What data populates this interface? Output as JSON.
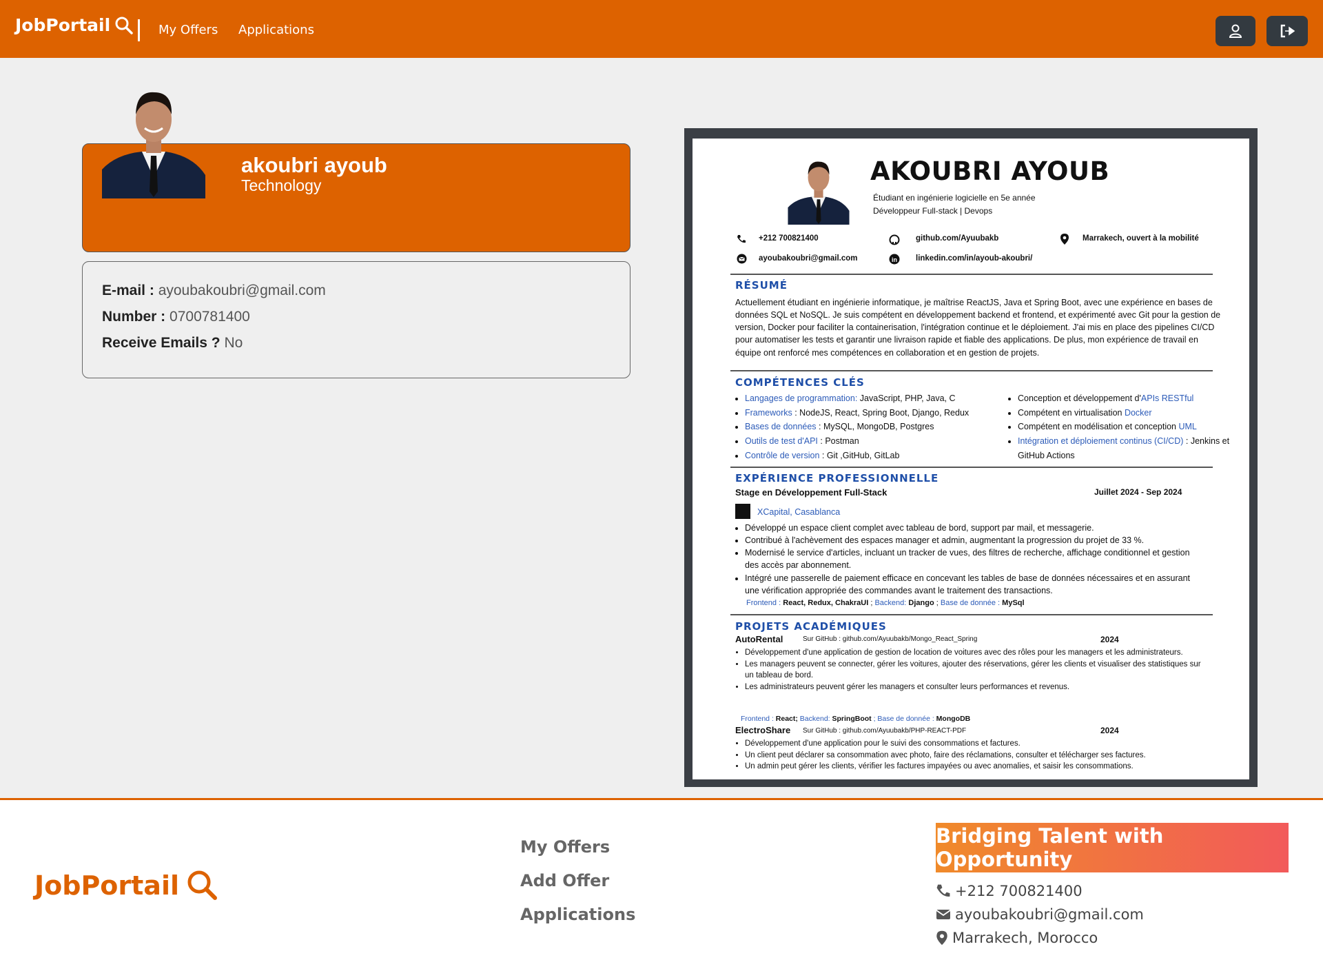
{
  "colors": {
    "brand": "#dd6200",
    "dark_button": "#333a40",
    "footer_text": "#666666"
  },
  "nav": {
    "brand": "JobPortail",
    "brand_icon": "search-icon",
    "links": [
      "My Offers",
      "Applications"
    ],
    "buttons": [
      {
        "icon": "user-icon"
      },
      {
        "icon": "logout-icon"
      }
    ]
  },
  "profile": {
    "name": "akoubri ayoub",
    "field": "Technology",
    "email_label": "E-mail :",
    "email": "ayoubakoubri@gmail.com",
    "number_label": "Number :",
    "number": "0700781400",
    "receive_label": "Receive Emails ?",
    "receive": "No"
  },
  "resume": {
    "name": "AKOUBRI AYOUB",
    "subtitle1": "Étudiant en ingénierie logicielle en 5e année",
    "subtitle2": "Développeur Full-stack | Devops",
    "phone": "+212 700821400",
    "github": "github.com/Ayuubakb",
    "location": "Marrakech, ouvert à la mobilité",
    "email": "ayoubakoubri@gmail.com",
    "linkedin": "linkedin.com/in/ayoub-akoubri/",
    "resume_title": "RÉSUMÉ",
    "resume_text": "Actuellement étudiant en ingénierie informatique, je maîtrise ReactJS, Java et Spring Boot, avec une expérience en bases de données SQL et NoSQL. Je suis compétent en développement backend et frontend, et expérimenté avec Git pour la gestion de version, Docker pour faciliter la containerisation, l'intégration continue et le déploiement. J'ai mis en place des pipelines CI/CD pour automatiser les tests et garantir une livraison rapide et fiable des applications. De plus, mon expérience de travail en équipe ont renforcé mes compétences en collaboration et en gestion de projets.",
    "skills_title": "COMPÉTENCES CLÉS",
    "skills_left": [
      {
        "k": "Langages de programmation:",
        "v": " JavaScript, PHP, Java, C"
      },
      {
        "k": "Frameworks",
        "v": " : NodeJS, React, Spring Boot, Django, Redux"
      },
      {
        "k": "Bases de données",
        "v": " : MySQL, MongoDB, Postgres"
      },
      {
        "k": "Outils de test d'API",
        "v": " : Postman"
      },
      {
        "k": "Contrôle de version",
        "v": " : Git ,GitHub, GitLab"
      }
    ],
    "skills_right": [
      {
        "p": "Conception et développement d'",
        "b": "APIs RESTful",
        "s": ""
      },
      {
        "p": "Compétent en virtualisation ",
        "b": "Docker",
        "s": ""
      },
      {
        "p": "Compétent en modélisation et conception ",
        "b": "UML",
        "s": ""
      },
      {
        "p": "",
        "b": "Intégration et déploiement continus (CI/CD)",
        "s": " : Jenkins et GitHub Actions"
      }
    ],
    "exp_title": "EXPÉRIENCE PROFESSIONNELLE",
    "exp_role": "Stage en Développement Full-Stack",
    "exp_dates": "Juillet 2024 - Sep 2024",
    "exp_company": "XCapital, Casablanca",
    "exp_items": [
      "Développé un espace client complet avec tableau de bord, support par mail, et messagerie.",
      "Contribué à l'achèvement des espaces manager et admin, augmentant la progression du projet de 33 %.",
      "Modernisé le service d'articles, incluant un tracker de vues, des filtres de recherche, affichage conditionnel et gestion des accès par abonnement.",
      "Intégré une passerelle de paiement efficace en concevant les tables de base de données nécessaires et en assurant une vérification appropriée des commandes avant le traitement des transactions."
    ],
    "exp_stack": {
      "f": "Frontend :",
      "fv": " React, Redux, ChakraUI",
      "b": "Backend:",
      "bv": " Django",
      "d": "Base de donnée :",
      "dv": " MySql"
    },
    "proj_title": "PROJETS ACADÉMIQUES",
    "proj1_name": "AutoRental",
    "proj1_link": "Sur GitHub : github.com/Ayuubakb/Mongo_React_Spring",
    "proj1_year": "2024",
    "proj1_items": [
      "Développement d'une application de gestion de location de voitures avec des rôles pour les managers et les administrateurs.",
      "Les managers peuvent se connecter, gérer les voitures, ajouter des réservations, gérer les clients et visualiser des statistiques sur un tableau de bord.",
      "Les administrateurs peuvent gérer les managers et consulter leurs performances et revenus."
    ],
    "proj1_stack": {
      "f": "Frontend :",
      "fv": " React;",
      "b": " Backend:",
      "bv": " SpringBoot",
      "d": " ; Base de donnée :",
      "dv": " MongoDB"
    },
    "proj2_name": "ElectroShare",
    "proj2_link": "Sur GitHub : github.com/Ayuubakb/PHP-REACT-PDF",
    "proj2_year": "2024",
    "proj2_items": [
      "Développement d'une application pour le suivi des consommations et factures.",
      "Un client peut déclarer sa consommation avec photo, faire des réclamations, consulter et télécharger ses factures.",
      "Un admin peut gérer les clients, vérifier les factures impayées ou avec anomalies, et saisir les consommations."
    ]
  },
  "footer": {
    "brand": "JobPortail",
    "links": [
      "My Offers",
      "Add Offer",
      "Applications"
    ],
    "tagline": "Bridging Talent with Opportunity",
    "phone": "+212 700821400",
    "email": "ayoubakoubri@gmail.com",
    "location": "Marrakech, Morocco"
  }
}
